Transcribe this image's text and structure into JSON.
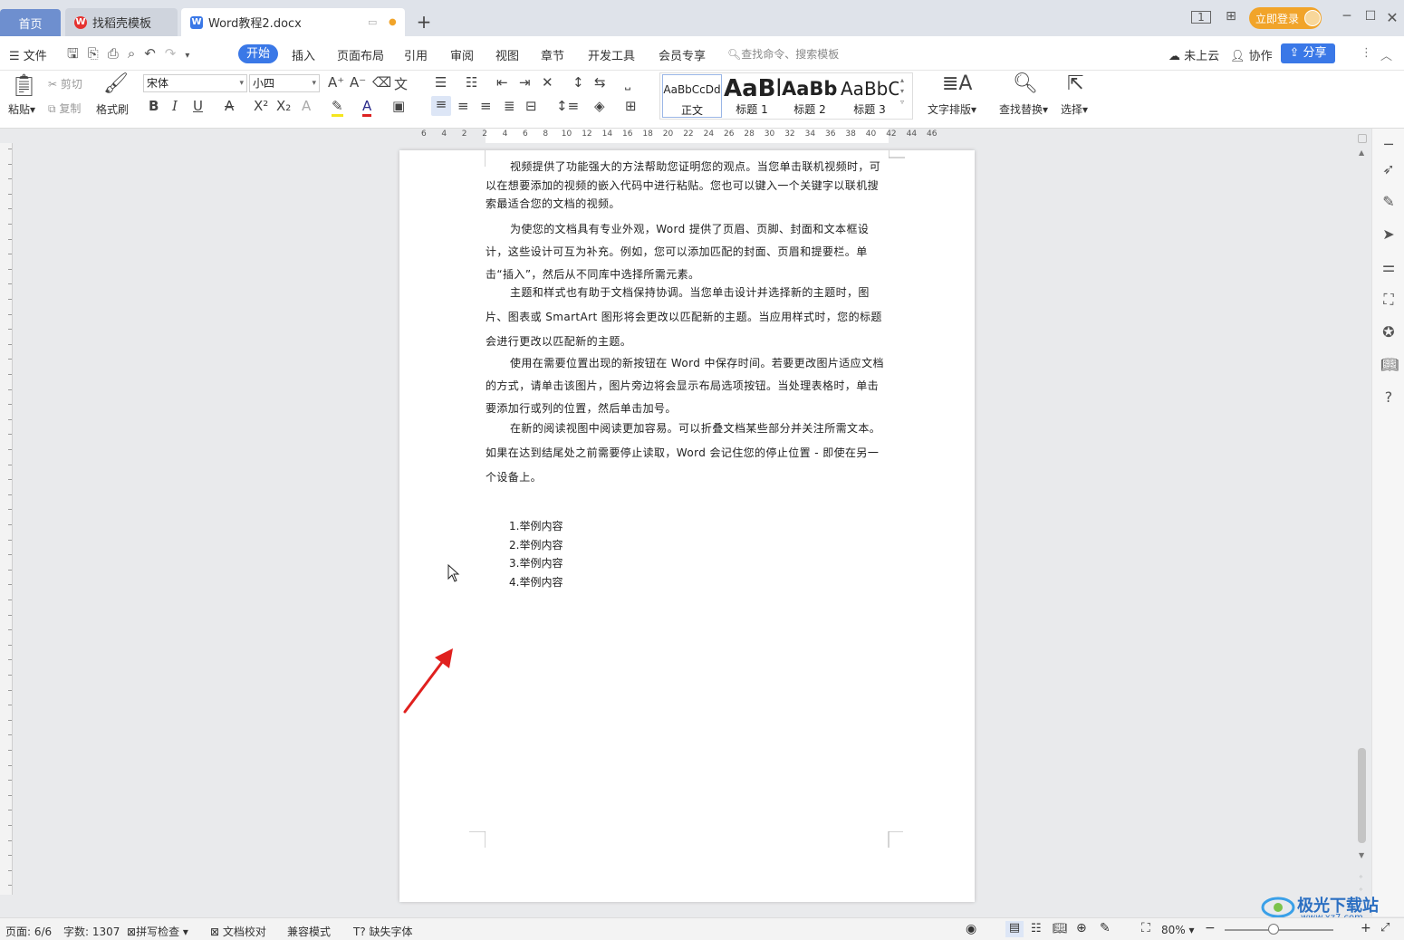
{
  "titlebar": {
    "tabs": [
      {
        "label": "首页"
      },
      {
        "label": "找稻壳模板"
      },
      {
        "label": "Word教程2.docx"
      }
    ],
    "login": "立即登录"
  },
  "menubar": {
    "file": "文件",
    "items": [
      "开始",
      "插入",
      "页面布局",
      "引用",
      "审阅",
      "视图",
      "章节",
      "开发工具",
      "会员专享"
    ],
    "search_placeholder": "查找命令、搜索模板",
    "cloud": "未上云",
    "collab": "协作",
    "share": "分享"
  },
  "ribbon": {
    "paste": "粘贴",
    "cut": "剪切",
    "copy": "复制",
    "format_painter": "格式刷",
    "font_name": "宋体",
    "font_size": "小四",
    "styles": [
      {
        "preview": "AaBbCcDd",
        "caption": "正文"
      },
      {
        "preview": "AaBl",
        "caption": "标题 1"
      },
      {
        "preview": "AaBb(",
        "caption": "标题 2"
      },
      {
        "preview": "AaBbC",
        "caption": "标题 3"
      }
    ],
    "text_layout": "文字排版",
    "find_replace": "查找替换",
    "select": "选择"
  },
  "ruler": {
    "ticks": [
      "6",
      "4",
      "2",
      "2",
      "4",
      "6",
      "8",
      "10",
      "12",
      "14",
      "16",
      "18",
      "20",
      "22",
      "24",
      "26",
      "28",
      "30",
      "32",
      "34",
      "36",
      "38",
      "40",
      "42",
      "44",
      "46"
    ]
  },
  "document": {
    "paragraphs": [
      "视频提供了功能强大的方法帮助您证明您的观点。当您单击联机视频时，可以在想要添加的视频的嵌入代码中进行粘贴。您也可以键入一个关键字以联机搜索最适合您的文档的视频。",
      "为使您的文档具有专业外观，Word 提供了页眉、页脚、封面和文本框设计，这些设计可互为补充。例如，您可以添加匹配的封面、页眉和提要栏。单击“插入”，然后从不同库中选择所需元素。",
      "主题和样式也有助于文档保持协调。当您单击设计并选择新的主题时，图片、图表或 SmartArt 图形将会更改以匹配新的主题。当应用样式时，您的标题会进行更改以匹配新的主题。",
      "使用在需要位置出现的新按钮在 Word 中保存时间。若要更改图片适应文档的方式，请单击该图片，图片旁边将会显示布局选项按钮。当处理表格时，单击要添加行或列的位置，然后单击加号。",
      "在新的阅读视图中阅读更加容易。可以折叠文档某些部分并关注所需文本。如果在达到结尾处之前需要停止读取，Word 会记住您的停止位置 - 即使在另一个设备上。"
    ],
    "list": [
      "1.举例内容",
      "2.举例内容",
      "3.举例内容",
      "4.举例内容"
    ]
  },
  "statusbar": {
    "page": "页面: 6/6",
    "words": "字数: 1307",
    "spellcheck": "拼写检查",
    "proofread": "文档校对",
    "compat": "兼容模式",
    "missing_font": "缺失字体",
    "zoom": "80%"
  },
  "watermark": {
    "text": "极光下载站",
    "url": "www.xz7.com"
  },
  "colors": {
    "accent": "#3a78e7",
    "login": "#f1a42a",
    "arrow": "#e0201e"
  }
}
